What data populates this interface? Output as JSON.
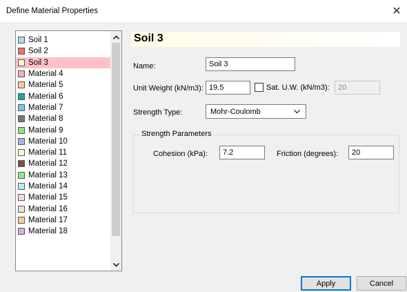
{
  "window": {
    "title": "Define Material Properties",
    "close_glyph": "✕"
  },
  "materials": [
    {
      "label": "Soil 1",
      "color": "#add8e6"
    },
    {
      "label": "Soil 2",
      "color": "#e9746f"
    },
    {
      "label": "Soil 3",
      "color": "#fff5cc",
      "selected": true
    },
    {
      "label": "Material 4",
      "color": "#f5b0b8"
    },
    {
      "label": "Material 5",
      "color": "#f7c99a"
    },
    {
      "label": "Material 6",
      "color": "#1ea89a"
    },
    {
      "label": "Material 7",
      "color": "#79c5ea"
    },
    {
      "label": "Material 8",
      "color": "#6e7b84"
    },
    {
      "label": "Material 9",
      "color": "#8fe08a"
    },
    {
      "label": "Material 10",
      "color": "#a9b7d8"
    },
    {
      "label": "Material 11",
      "color": "#fbf6d5"
    },
    {
      "label": "Material 12",
      "color": "#7a5048"
    },
    {
      "label": "Material 13",
      "color": "#8de88a"
    },
    {
      "label": "Material 14",
      "color": "#b5ecec"
    },
    {
      "label": "Material 15",
      "color": "#f9d9d9"
    },
    {
      "label": "Material 16",
      "color": "#eae4d4"
    },
    {
      "label": "Material 17",
      "color": "#f4cf9a"
    },
    {
      "label": "Material 18",
      "color": "#d5b0d8"
    }
  ],
  "properties": {
    "heading": "Soil 3",
    "name_label": "Name:",
    "name_value": "Soil 3",
    "unit_weight_label": "Unit Weight (kN/m3):",
    "unit_weight_value": "19.5",
    "sat_uw_label": "Sat. U.W. (kN/m3):",
    "sat_uw_value": "20",
    "sat_uw_checked": false,
    "strength_type_label": "Strength Type:",
    "strength_type_value": "Mohr-Coulomb",
    "group_title": "Strength Parameters",
    "cohesion_label": "Cohesion (kPa):",
    "cohesion_value": "7.2",
    "friction_label": "Friction (degrees):",
    "friction_value": "20"
  },
  "buttons": {
    "apply": "Apply",
    "cancel": "Cancel"
  },
  "icons": {
    "close": "close-icon",
    "scroll_up": "chevron-up-icon",
    "scroll_down": "chevron-down-icon",
    "dropdown": "chevron-down-icon"
  }
}
